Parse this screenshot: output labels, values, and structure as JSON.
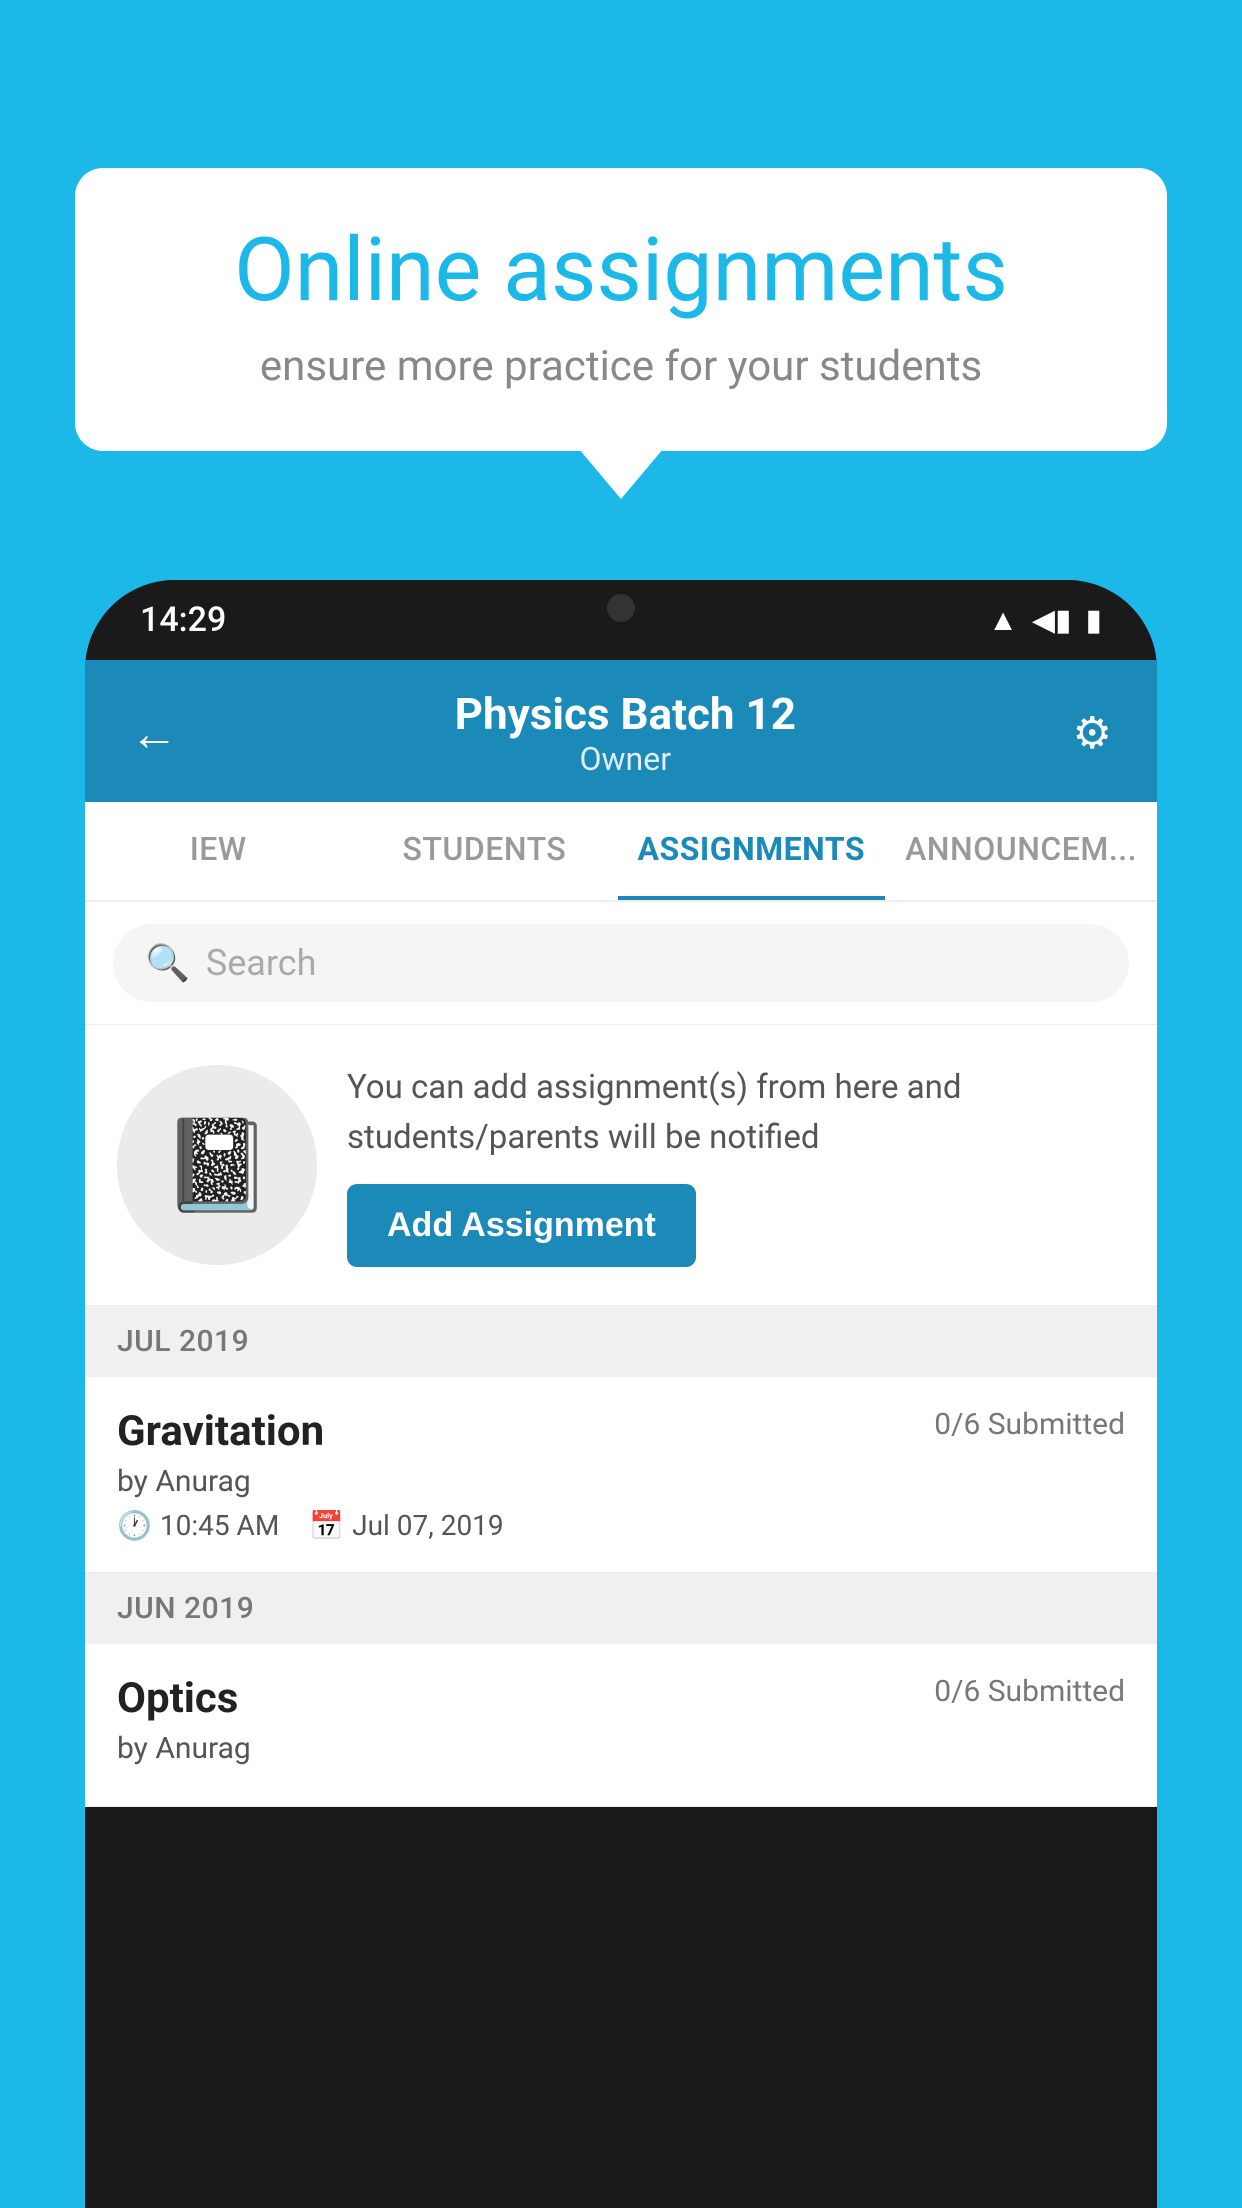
{
  "background_color": "#1bb8e8",
  "speech_bubble": {
    "title": "Online assignments",
    "subtitle": "ensure more practice for your students"
  },
  "phone": {
    "status_bar": {
      "time": "14:29",
      "icons": [
        "wifi",
        "signal",
        "battery"
      ]
    },
    "header": {
      "title": "Physics Batch 12",
      "subtitle": "Owner",
      "back_label": "←",
      "settings_label": "⚙"
    },
    "tabs": [
      {
        "label": "IEW",
        "active": false
      },
      {
        "label": "STUDENTS",
        "active": false
      },
      {
        "label": "ASSIGNMENTS",
        "active": true
      },
      {
        "label": "ANNOUNCEM...",
        "active": false
      }
    ],
    "search": {
      "placeholder": "Search"
    },
    "promo": {
      "text": "You can add assignment(s) from here and students/parents will be notified",
      "button_label": "Add Assignment"
    },
    "month_groups": [
      {
        "month": "JUL 2019",
        "assignments": [
          {
            "name": "Gravitation",
            "submitted": "0/6 Submitted",
            "by": "by Anurag",
            "time": "10:45 AM",
            "date": "Jul 07, 2019"
          }
        ]
      },
      {
        "month": "JUN 2019",
        "assignments": [
          {
            "name": "Optics",
            "submitted": "0/6 Submitted",
            "by": "by Anurag",
            "time": "",
            "date": ""
          }
        ]
      }
    ]
  }
}
